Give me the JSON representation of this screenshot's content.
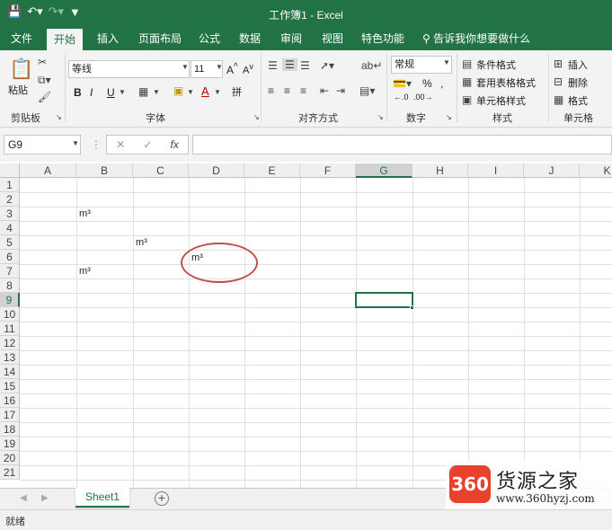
{
  "titlebar": {
    "title": "工作簿1 - Excel"
  },
  "tabs": [
    {
      "label": "文件"
    },
    {
      "label": "开始"
    },
    {
      "label": "插入"
    },
    {
      "label": "页面布局"
    },
    {
      "label": "公式"
    },
    {
      "label": "数据"
    },
    {
      "label": "审阅"
    },
    {
      "label": "视图"
    },
    {
      "label": "特色功能"
    }
  ],
  "tellme": "告诉我你想要做什么",
  "ribbon": {
    "paste": "粘贴",
    "font_name": "等线",
    "font_size": "11",
    "number_format": "常规",
    "cond_format": "条件格式",
    "table_format": "套用表格格式",
    "cell_style": "单元格样式",
    "insert": "插入",
    "delete": "删除",
    "format": "格式",
    "groups": [
      "剪贴板",
      "字体",
      "对齐方式",
      "数字",
      "样式",
      "单元格"
    ]
  },
  "namebox": "G9",
  "fx": "fx",
  "columns": [
    "A",
    "B",
    "C",
    "D",
    "E",
    "F",
    "G",
    "H",
    "I",
    "J",
    "K"
  ],
  "rows": [
    "1",
    "2",
    "3",
    "4",
    "5",
    "6",
    "7",
    "8",
    "9",
    "10",
    "11",
    "12",
    "13",
    "14",
    "15",
    "16",
    "17",
    "18",
    "19",
    "20",
    "21"
  ],
  "cells": {
    "b3": "m³",
    "c5": "m³",
    "d6": "m³",
    "b7": "m³"
  },
  "sheet_tab": "Sheet1",
  "status": "就绪",
  "watermark": {
    "badge": "360",
    "name": "货源之家",
    "url": "www.360hyzj.com"
  },
  "colors": {
    "accent": "#217346",
    "annotation_circle": "#c0504d"
  }
}
